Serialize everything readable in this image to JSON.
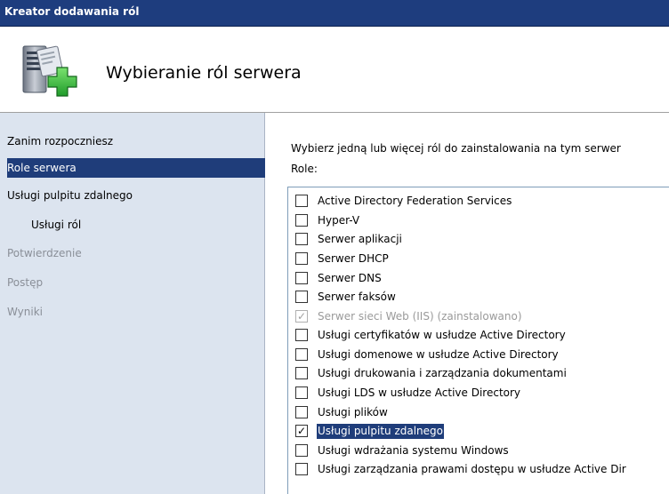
{
  "window": {
    "title": "Kreator dodawania ról"
  },
  "header": {
    "heading": "Wybieranie ról serwera",
    "icon": "server-add-icon"
  },
  "sidebar": {
    "items": [
      {
        "label": "Zanim rozpoczniesz",
        "state": "normal"
      },
      {
        "label": "Role serwera",
        "state": "active"
      },
      {
        "label": "Usługi pulpitu zdalnego",
        "state": "normal"
      },
      {
        "label": "Usługi ról",
        "state": "sub"
      },
      {
        "label": "Potwierdzenie",
        "state": "disabled"
      },
      {
        "label": "Postęp",
        "state": "disabled"
      },
      {
        "label": "Wyniki",
        "state": "disabled"
      }
    ]
  },
  "main": {
    "instruction": "Wybierz jedną lub więcej ról do zainstalowania na tym serwer",
    "roles_label": "Role:",
    "roles": [
      {
        "label": "Active Directory Federation Services",
        "checked": false,
        "disabled": false
      },
      {
        "label": "Hyper-V",
        "checked": false,
        "disabled": false
      },
      {
        "label": "Serwer aplikacji",
        "checked": false,
        "disabled": false
      },
      {
        "label": "Serwer DHCP",
        "checked": false,
        "disabled": false
      },
      {
        "label": "Serwer DNS",
        "checked": false,
        "disabled": false
      },
      {
        "label": "Serwer faksów",
        "checked": false,
        "disabled": false
      },
      {
        "label": "Serwer sieci Web (IIS) (zainstalowano)",
        "checked": true,
        "disabled": true
      },
      {
        "label": "Usługi certyfikatów w usłudze Active Directory",
        "checked": false,
        "disabled": false
      },
      {
        "label": "Usługi domenowe w usłudze Active Directory",
        "checked": false,
        "disabled": false
      },
      {
        "label": "Usługi drukowania i zarządzania dokumentami",
        "checked": false,
        "disabled": false
      },
      {
        "label": "Usługi LDS w usłudze Active Directory",
        "checked": false,
        "disabled": false
      },
      {
        "label": "Usługi plików",
        "checked": false,
        "disabled": false
      },
      {
        "label": "Usługi pulpitu zdalnego",
        "checked": true,
        "disabled": false,
        "selected": true
      },
      {
        "label": "Usługi wdrażania systemu Windows",
        "checked": false,
        "disabled": false
      },
      {
        "label": "Usługi zarządzania prawami dostępu w usłudze Active Dir",
        "checked": false,
        "disabled": false
      }
    ]
  },
  "colors": {
    "titlebar": "#1e3d7e",
    "sidebar_bg": "#dce4ef",
    "selection": "#1f3d7a",
    "disabled_text": "#8a8f98"
  }
}
